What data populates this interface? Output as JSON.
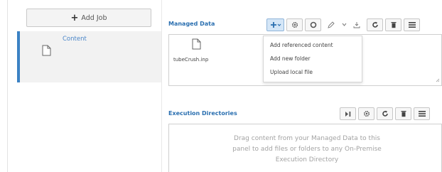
{
  "jobs_panel": {
    "add_job_label": "Add Job",
    "items": [
      {
        "label": "Content",
        "icon": "document-icon"
      }
    ]
  },
  "managed_data": {
    "title": "Managed Data",
    "toolbar": [
      "add-menu-icon",
      "gear-icon",
      "circle-icon",
      "pencil-icon",
      "chevron-down-icon",
      "download-icon",
      "refresh-icon",
      "trash-icon",
      "list-icon"
    ],
    "files": [
      {
        "name": "tubeCrush.inp",
        "icon": "document-icon"
      }
    ],
    "add_menu": [
      "Add referenced content",
      "Add new folder",
      "Upload local file"
    ]
  },
  "execution_directories": {
    "title": "Execution Directories",
    "toolbar": [
      "skip-icon",
      "gear-icon",
      "refresh-icon",
      "trash-icon",
      "list-icon"
    ],
    "help_lines": [
      "Drag content from your Managed Data to this",
      "panel to add files or folders to any On-Premise",
      "Execution Directory"
    ]
  },
  "colors": {
    "accent": "#3b82c4",
    "title": "#2a6fb0",
    "active_button": "#d4e6f7"
  }
}
